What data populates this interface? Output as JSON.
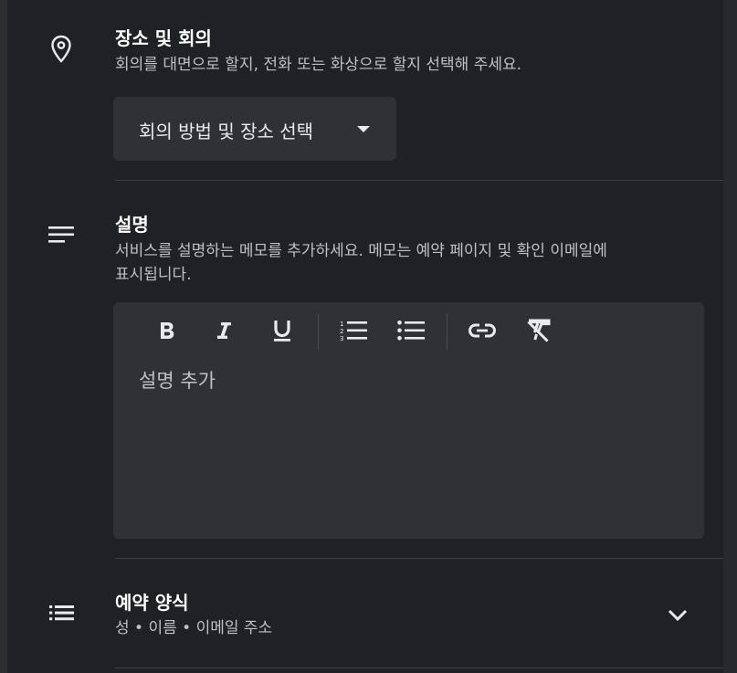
{
  "location": {
    "title": "장소 및 회의",
    "subtitle": "회의를 대면으로 할지, 전화 또는 화상으로 할지 선택해 주세요.",
    "dropdown_label": "회의 방법 및 장소 선택",
    "icon": "location-pin-icon"
  },
  "description": {
    "title": "설명",
    "subtitle_line1": "서비스를 설명하는 메모를 추가하세요. 메모는 예약 페이지 및 확인 이메일에",
    "subtitle_line2": "표시됩니다.",
    "placeholder": "설명 추가",
    "icon": "notes-icon",
    "toolbar": [
      "bold-icon",
      "italic-icon",
      "underline-icon",
      "numbered-list-icon",
      "bulleted-list-icon",
      "link-icon",
      "clear-formatting-icon"
    ]
  },
  "booking_form": {
    "title": "예약 양식",
    "subtitle": "성 • 이름 • 이메일 주소",
    "icon": "form-list-icon"
  },
  "colors": {
    "background": "#202124",
    "panel": "#303134",
    "text_primary": "#ffffff",
    "text_secondary": "#bdc1c6",
    "icon": "#e8eaed"
  }
}
